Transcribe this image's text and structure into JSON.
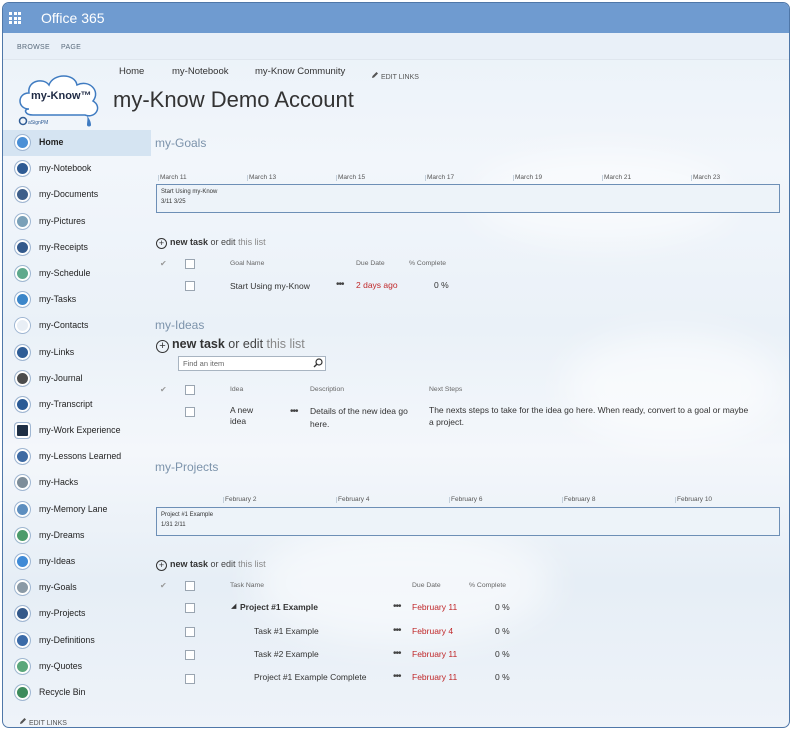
{
  "suite": {
    "title": "Office 365"
  },
  "ribbon": {
    "tabs": [
      "BROWSE",
      "PAGE"
    ]
  },
  "logo": {
    "text": "my-Know™",
    "sub": "aSignPM"
  },
  "topnav": {
    "items": [
      "Home",
      "my-Notebook",
      "my-Know Community"
    ],
    "edit_links": "EDIT LINKS"
  },
  "site": {
    "title": "my-Know Demo Account"
  },
  "leftnav": {
    "items": [
      "Home",
      "my-Notebook",
      "my-Documents",
      "my-Pictures",
      "my-Receipts",
      "my-Schedule",
      "my-Tasks",
      "my-Contacts",
      "my-Links",
      "my-Journal",
      "my-Transcript",
      "my-Work Experience",
      "my-Lessons Learned",
      "my-Hacks",
      "my-Memory Lane",
      "my-Dreams",
      "my-Ideas",
      "my-Goals",
      "my-Projects",
      "my-Definitions",
      "my-Quotes",
      "Recycle Bin"
    ],
    "edit_links": "EDIT LINKS"
  },
  "goals": {
    "title": "my-Goals",
    "timeline": {
      "dates": [
        "March 11",
        "March 13",
        "March 15",
        "March 17",
        "March 19",
        "March 21",
        "March 23"
      ],
      "bar_title": "Start Using my-Know",
      "bar_range": "3/11   3/25"
    },
    "new_task": "new task",
    "or_edit": "or edit",
    "this_list": "this list",
    "columns": {
      "name": "Goal Name",
      "due": "Due Date",
      "complete": "% Complete"
    },
    "rows": [
      {
        "name": "Start Using my-Know",
        "due": "2 days ago",
        "complete": "0 %"
      }
    ]
  },
  "ideas": {
    "title": "my-Ideas",
    "new_task": "new task",
    "or_edit": "or edit",
    "this_list": "this list",
    "search_placeholder": "Find an item",
    "columns": {
      "idea": "Idea",
      "description": "Description",
      "next": "Next Steps"
    },
    "rows": [
      {
        "idea_line1": "A new",
        "idea_line2": "idea",
        "desc_line1": "Details of the new idea go",
        "desc_line2": "here.",
        "next_line1": "The nexts steps to take for the idea go here. When ready, convert to a goal or maybe",
        "next_line2": "a project."
      }
    ]
  },
  "projects": {
    "title": "my-Projects",
    "timeline": {
      "dates": [
        "February 2",
        "February 4",
        "February 6",
        "February 8",
        "February 10"
      ],
      "bar_title": "Project #1 Example",
      "bar_range": "1/31   2/11"
    },
    "new_task": "new task",
    "or_edit": "or edit",
    "this_list": "this list",
    "columns": {
      "name": "Task Name",
      "due": "Due Date",
      "complete": "% Complete"
    },
    "rows": [
      {
        "name": "Project #1 Example",
        "due": "February 11",
        "complete": "0 %"
      },
      {
        "name": "Task #1 Example",
        "due": "February 4",
        "complete": "0 %"
      },
      {
        "name": "Task #2 Example",
        "due": "February 11",
        "complete": "0 %"
      },
      {
        "name": "Project #1 Example Complete",
        "due": "February 11",
        "complete": "0 %"
      }
    ]
  },
  "colors": {
    "suite_bar": "#6f9bd0",
    "nav_icon": "#2e5b94",
    "overdue": "#c0282a"
  }
}
